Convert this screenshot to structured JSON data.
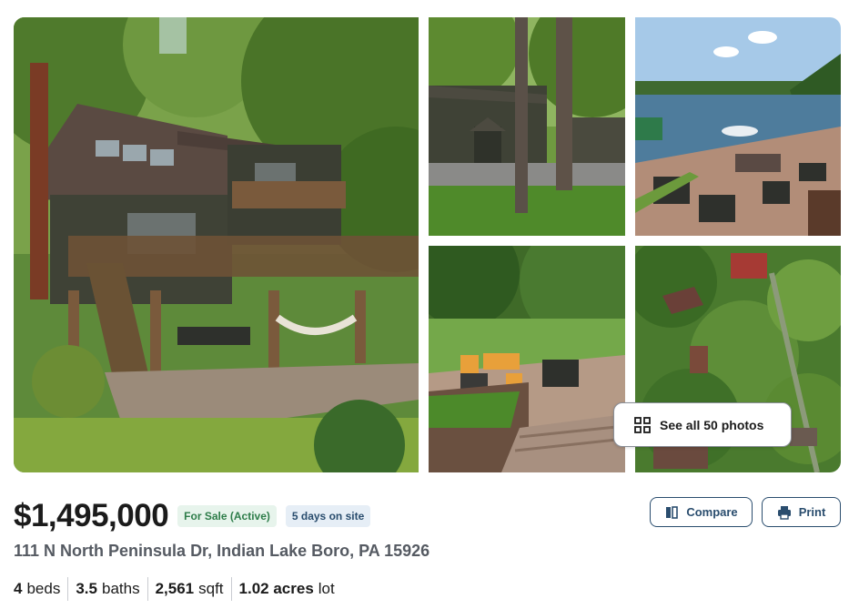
{
  "gallery": {
    "photos": [
      {
        "id": "main",
        "icon": "house-exterior-photo"
      },
      {
        "id": "p1",
        "icon": "house-front-photo"
      },
      {
        "id": "p2",
        "icon": "lake-patio-photo"
      },
      {
        "id": "p3",
        "icon": "backyard-patio-photo"
      },
      {
        "id": "p4",
        "icon": "aerial-view-photo"
      }
    ],
    "see_all_label": "See all 50 photos",
    "see_all_icon": "grid-icon"
  },
  "listing": {
    "price": "$1,495,000",
    "status_badge": "For Sale (Active)",
    "days_badge": "5 days on site",
    "address": "111 N North Peninsula Dr, Indian Lake Boro, PA 15926",
    "facts": {
      "beds_value": "4",
      "beds_label": "beds",
      "baths_value": "3.5",
      "baths_label": "baths",
      "sqft_value": "2,561",
      "sqft_label": "sqft",
      "lot_value": "1.02 acres",
      "lot_label": "lot"
    }
  },
  "actions": {
    "compare_label": "Compare",
    "compare_icon": "compare-icon",
    "print_label": "Print",
    "print_icon": "printer-icon"
  },
  "colors": {
    "accent": "#2a4d6e",
    "sale_badge_bg": "#e7f4ec",
    "sale_badge_text": "#2e7d4a",
    "days_badge_bg": "#e6eef6"
  }
}
